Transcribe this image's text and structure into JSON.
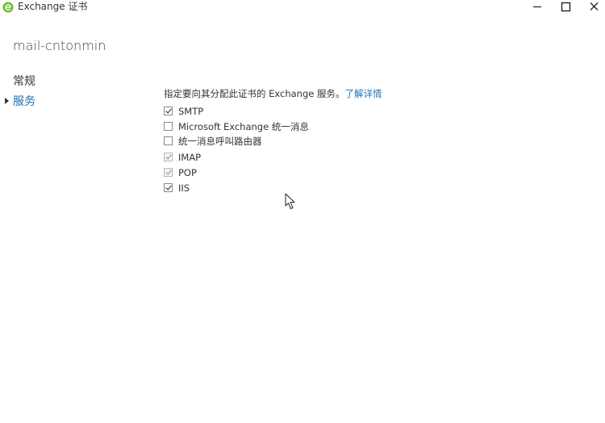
{
  "window": {
    "title": "Exchange 证书",
    "icon": "exchange-app-icon",
    "controls": {
      "minimize": "minimize-icon",
      "maximize": "maximize-icon",
      "close": "close-icon"
    }
  },
  "header": {
    "server_name": "mail-cntonmin"
  },
  "nav": {
    "items": [
      {
        "label": "常规",
        "selected": false
      },
      {
        "label": "服务",
        "selected": true
      }
    ]
  },
  "content": {
    "instruction": "指定要向其分配此证书的 Exchange 服务。",
    "learn_more": "了解详情",
    "options": [
      {
        "label": "SMTP",
        "checked": true,
        "disabled": false
      },
      {
        "label": "Microsoft Exchange 统一消息",
        "checked": false,
        "disabled": false
      },
      {
        "label": "统一消息呼叫路由器",
        "checked": false,
        "disabled": false
      },
      {
        "label": "IMAP",
        "checked": true,
        "disabled": true
      },
      {
        "label": "POP",
        "checked": true,
        "disabled": true
      },
      {
        "label": "IIS",
        "checked": true,
        "disabled": false
      }
    ]
  },
  "colors": {
    "accent": "#1e6fb0",
    "app_icon": "#6cbf2f"
  }
}
